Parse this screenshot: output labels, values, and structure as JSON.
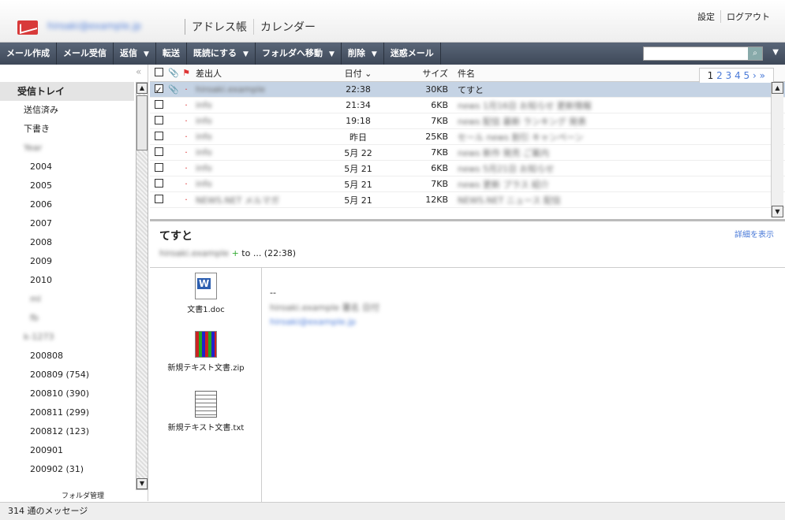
{
  "header": {
    "account": "hiroaki@example.jp",
    "nav": [
      "アドレス帳",
      "カレンダー"
    ],
    "links": [
      "設定",
      "ログアウト"
    ]
  },
  "toolbar": {
    "items": [
      "メール作成",
      "メール受信",
      "返信",
      "転送",
      "既読にする",
      "フォルダへ移動",
      "削除",
      "迷惑メール"
    ]
  },
  "search": {
    "placeholder": ""
  },
  "sidebar": {
    "folders": [
      "受信トレイ",
      "送信済み",
      "下書き",
      "Year",
      "2004",
      "2005",
      "2006",
      "2007",
      "2008",
      "2009",
      "2010",
      "ml",
      "fb",
      "k-1273",
      "200808",
      "200809 (754)",
      "200810 (390)",
      "200811 (299)",
      "200812 (123)",
      "200901",
      "200902 (31)"
    ],
    "folder_mgr": "フォルダ管理"
  },
  "list": {
    "headers": {
      "from": "差出人",
      "date": "日付",
      "size": "サイズ",
      "subject": "件名"
    },
    "pager": {
      "current": "1",
      "pages": [
        "2",
        "3",
        "4",
        "5"
      ]
    },
    "rows": [
      {
        "from": "hiroaki.example",
        "date": "22:38",
        "size": "30KB",
        "subject": "てすと",
        "checked": true
      },
      {
        "from": "info",
        "date": "21:34",
        "size": "6KB",
        "subject": "news 1月16日 お知らせ 更新情報",
        "checked": false
      },
      {
        "from": "info",
        "date": "19:18",
        "size": "7KB",
        "subject": "news 配信 最新 ランキング 発表",
        "checked": false
      },
      {
        "from": "info",
        "date": "昨日",
        "size": "25KB",
        "subject": "セール news 割引 キャンペーン",
        "checked": false
      },
      {
        "from": "info",
        "date": "5月 22",
        "size": "7KB",
        "subject": "news 新作 発売 ご案内",
        "checked": false
      },
      {
        "from": "info",
        "date": "5月 21",
        "size": "6KB",
        "subject": "news 5月21日 お知らせ",
        "checked": false
      },
      {
        "from": "info",
        "date": "5月 21",
        "size": "7KB",
        "subject": "news 更新 プラス 紹介",
        "checked": false
      },
      {
        "from": "NEWS.NET メルマガ",
        "date": "5月 21",
        "size": "12KB",
        "subject": "NEWS.NET ニュース 配信",
        "checked": false
      }
    ]
  },
  "preview": {
    "title": "てすと",
    "detail": "詳細を表示",
    "from": "hiroaki.example",
    "to": "to ... (22:38)",
    "attachments": [
      "文書1.doc",
      "新規テキスト文書.zip",
      "新規テキスト文書.txt"
    ],
    "body_sig": "--",
    "body_line1": "hiroaki.example 署名 日付",
    "body_line2": "hiroaki@example.jp"
  },
  "status": "314 通のメッセージ"
}
